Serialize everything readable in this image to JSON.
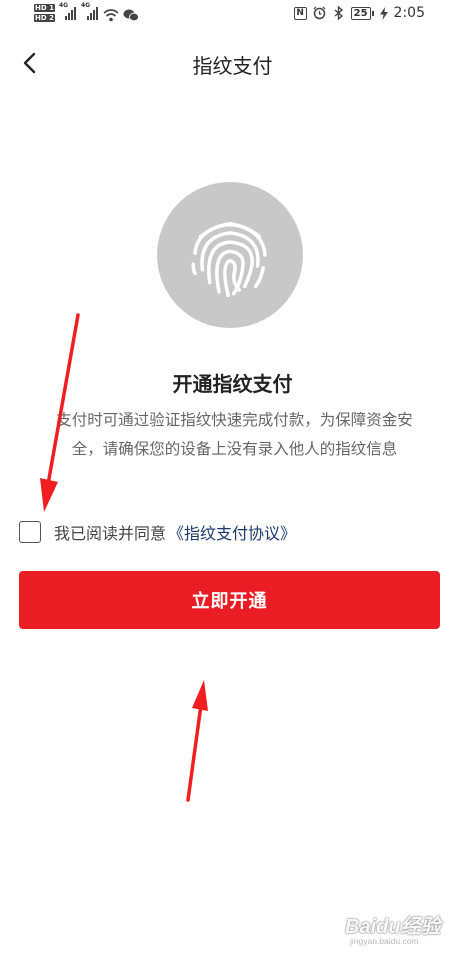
{
  "status_bar": {
    "sim1_label": "HD 1",
    "sim2_label": "HD 2",
    "signal1_gen": "4G",
    "signal2_gen": "4G",
    "battery_level": "25",
    "time": "2:05"
  },
  "nav": {
    "title": "指纹支付"
  },
  "main": {
    "heading": "开通指纹支付",
    "description_line1": "支付时可通过验证指纹快速完成付款，为保障资金安",
    "description_line2": "全，请确保您的设备上没有录入他人的指纹信息",
    "agree_text": "我已阅读并同意",
    "agree_link": "《指纹支付协议》",
    "agree_checked": false,
    "primary_button": "立即开通"
  },
  "watermark": {
    "logo": "Baidu经验",
    "url": "jingyan.baidu.com"
  },
  "colors": {
    "accent": "#ea1c24",
    "link": "#1b3a6b",
    "fingerprint_bg": "#c8c8c8",
    "annotation_arrow": "#f01e1e"
  },
  "icons": [
    "back-arrow-icon",
    "fingerprint-icon",
    "checkbox-icon",
    "wifi-icon",
    "wechat-icon",
    "nfc-icon",
    "alarm-icon",
    "bluetooth-icon",
    "battery-icon",
    "charging-icon"
  ]
}
